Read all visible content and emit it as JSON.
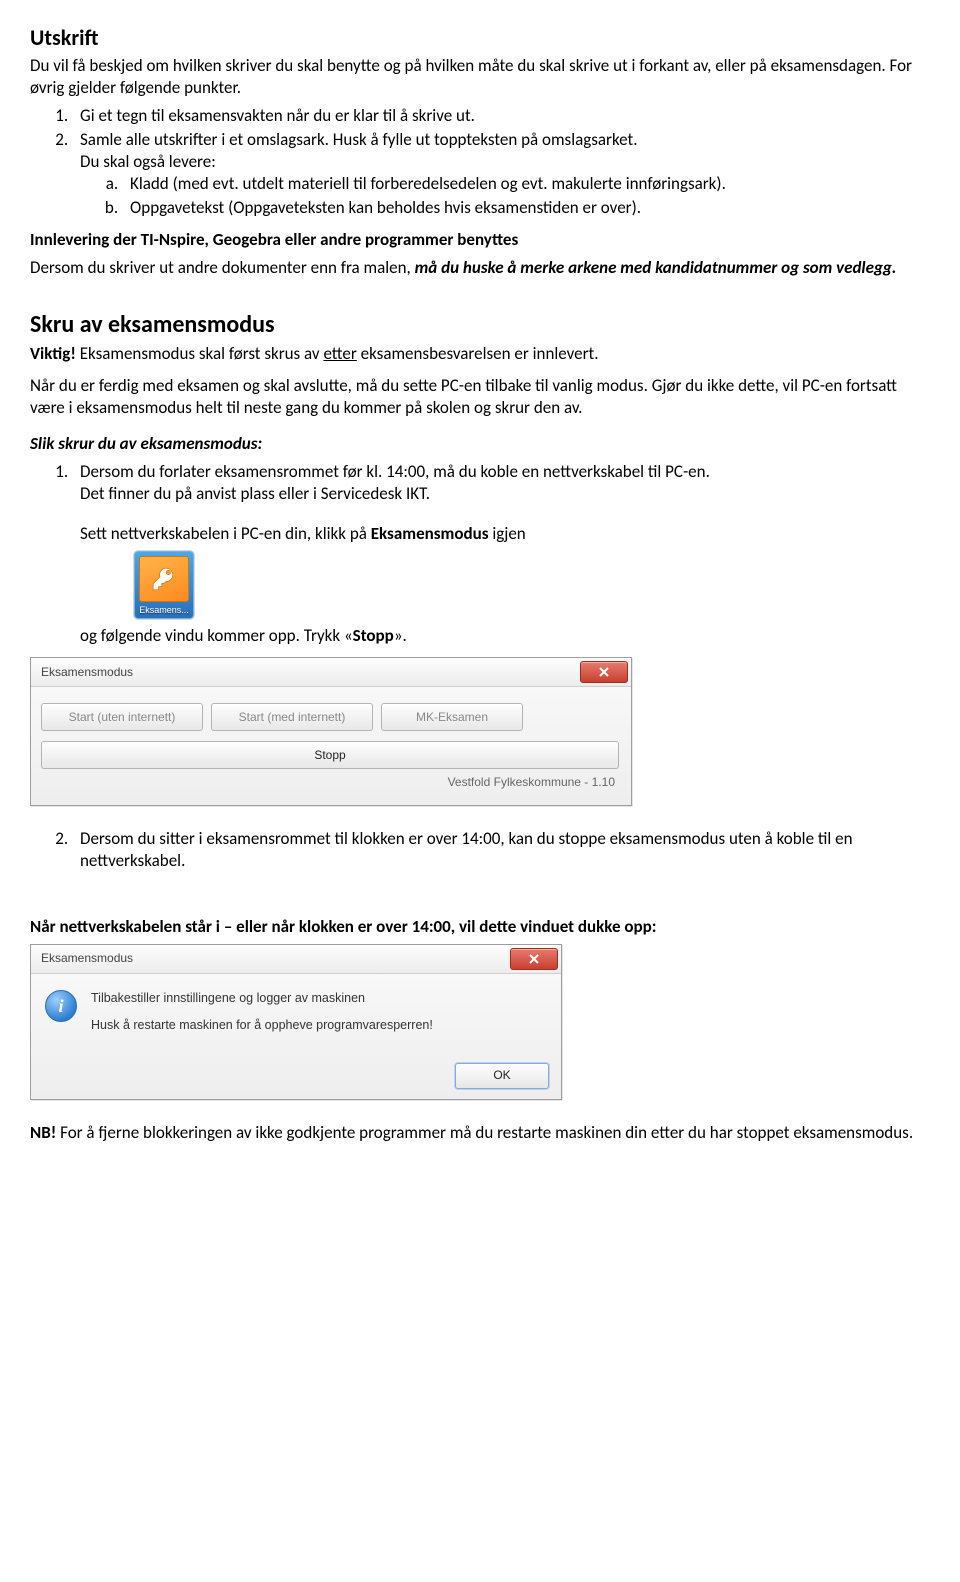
{
  "h_utskrift": "Utskrift",
  "p_utskrift_intro": "Du vil få beskjed om hvilken skriver du skal benytte og på hvilken måte du skal skrive ut i forkant av, eller på eksamensdagen. For øvrig gjelder følgende punkter.",
  "ol1_1": "Gi et tegn til eksamensvakten når du er klar til å skrive ut.",
  "ol1_2": "Samle alle utskrifter i et omslagsark. Husk å fylle ut toppteksten på omslagsarket.",
  "ol1_2b": "Du skal også levere:",
  "ol1_2a_a": "Kladd (med evt. utdelt materiell til forberedelsedelen og evt. makulerte innføringsark).",
  "ol1_2a_b": "Oppgavetekst (Oppgaveteksten kan beholdes hvis eksamenstiden er over).",
  "h_innlevering": "Innlevering der TI-Nspire, Geogebra eller andre programmer benyttes",
  "p_innlevering_1": "Dersom du skriver ut andre dokumenter enn fra malen, ",
  "p_innlevering_2": "må du huske å merke arkene med kandidatnummer og som vedlegg.",
  "h_skruav": "Skru av eksamensmodus",
  "viktig_label": "Viktig!",
  "viktig_rest": " Eksamensmodus skal først skrus av ",
  "viktig_underline": "etter",
  "viktig_rest2": " eksamensbesvarelsen er innlevert.",
  "p_ferdig": "Når du er ferdig med eksamen og skal avslutte, må du sette PC-en tilbake til vanlig modus. Gjør du ikke dette, vil PC-en fortsatt være i eksamensmodus helt til neste gang du kommer på skolen og skrur den av.",
  "slik_header": "Slik skrur du av eksamensmodus:",
  "ol2_1a": "Dersom du forlater eksamensrommet før kl. 14:00, må du koble en nettverkskabel til PC-en.",
  "ol2_1b": "Det finner du på anvist plass eller i Servicedesk IKT.",
  "sett_kabel_1": "Sett nettverkskabelen i PC-en din, klikk på ",
  "sett_kabel_2": "Eksamensmodus",
  "sett_kabel_3": " igjen",
  "ikon_label": "Eksamens...",
  "og_folgende_1": "og følgende vindu kommer opp. Trykk «",
  "og_folgende_2": "Stopp",
  "og_folgende_3": "».",
  "dlg_title": "Eksamensmodus",
  "close_x": "×",
  "btn_start1": "Start (uten internett)",
  "btn_start2": "Start (med internett)",
  "btn_mk": "MK-Eksamen",
  "btn_stopp": "Stopp",
  "vendor": "Vestfold Fylkeskommune - 1.10",
  "ol2_2": "Dersom du sitter i eksamensrommet til klokken er over 14:00, kan du stoppe eksamensmodus uten å koble til en nettverkskabel.",
  "nett_heading": "Når nettverkskabelen står i – eller når klokken er over 14:00, vil dette vinduet dukke opp:",
  "dlg2_line1": "Tilbakestiller innstillingene og logger av maskinen",
  "dlg2_line2": "Husk å restarte maskinen for å oppheve programvaresperren!",
  "info_i": "i",
  "ok_label": "OK",
  "nb_label": "NB!",
  "nb_rest": " For å fjerne blokkeringen av ikke godkjente programmer må du restarte maskinen din etter du har stoppet eksamensmodus."
}
